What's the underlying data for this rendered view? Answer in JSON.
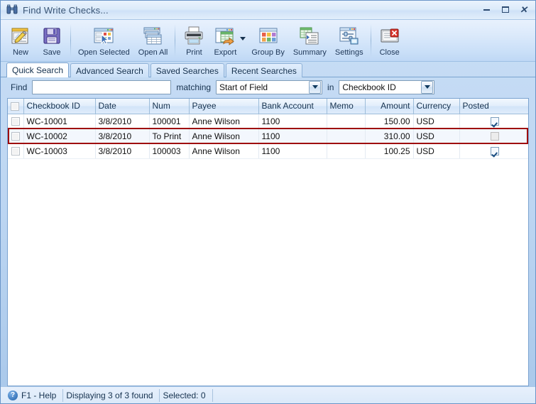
{
  "window": {
    "title": "Find Write Checks...",
    "icon": "binoculars-icon",
    "controls": {
      "minimize": "Minimize",
      "maximize": "Maximize",
      "close": "Close"
    }
  },
  "toolbar": {
    "items": [
      {
        "label": "New",
        "icon": "new-document-icon"
      },
      {
        "label": "Save",
        "icon": "floppy-disk-icon"
      },
      {
        "label": "Open Selected",
        "icon": "open-selected-icon"
      },
      {
        "label": "Open All",
        "icon": "open-all-icon"
      },
      {
        "label": "Print",
        "icon": "printer-icon"
      },
      {
        "label": "Export",
        "icon": "export-icon",
        "has_dropdown": true
      },
      {
        "label": "Group By",
        "icon": "group-by-icon"
      },
      {
        "label": "Summary",
        "icon": "summary-icon"
      },
      {
        "label": "Settings",
        "icon": "settings-icon"
      },
      {
        "label": "Close",
        "icon": "close-window-icon"
      }
    ]
  },
  "tabs": [
    {
      "label": "Quick Search",
      "active": true
    },
    {
      "label": "Advanced Search",
      "active": false
    },
    {
      "label": "Saved Searches",
      "active": false
    },
    {
      "label": "Recent Searches",
      "active": false
    }
  ],
  "search": {
    "find_label": "Find",
    "find_value": "",
    "find_placeholder": "",
    "matching_label": "matching",
    "matching_value": "Start of Field",
    "in_label": "in",
    "in_value": "Checkbook ID"
  },
  "grid": {
    "columns": [
      {
        "key": "select",
        "label": "",
        "align": "center"
      },
      {
        "key": "checkbook_id",
        "label": "Checkbook ID",
        "align": "left"
      },
      {
        "key": "date",
        "label": "Date",
        "align": "left"
      },
      {
        "key": "num",
        "label": "Num",
        "align": "left"
      },
      {
        "key": "payee",
        "label": "Payee",
        "align": "left"
      },
      {
        "key": "bank_account",
        "label": "Bank Account",
        "align": "left"
      },
      {
        "key": "memo",
        "label": "Memo",
        "align": "left"
      },
      {
        "key": "amount",
        "label": "Amount",
        "align": "right"
      },
      {
        "key": "currency",
        "label": "Currency",
        "align": "left"
      },
      {
        "key": "posted",
        "label": "Posted",
        "align": "center"
      }
    ],
    "rows": [
      {
        "selected": false,
        "highlighted": false,
        "checkbook_id": "WC-10001",
        "date": "3/8/2010",
        "num": "100001",
        "payee": "Anne Wilson",
        "bank_account": "1100",
        "memo": "",
        "amount": "150.00",
        "currency": "USD",
        "posted": true
      },
      {
        "selected": false,
        "highlighted": true,
        "checkbook_id": "WC-10002",
        "date": "3/8/2010",
        "num": "To Print",
        "payee": "Anne Wilson",
        "bank_account": "1100",
        "memo": "",
        "amount": "310.00",
        "currency": "USD",
        "posted": false
      },
      {
        "selected": false,
        "highlighted": false,
        "checkbook_id": "WC-10003",
        "date": "3/8/2010",
        "num": "100003",
        "payee": "Anne Wilson",
        "bank_account": "1100",
        "memo": "",
        "amount": "100.25",
        "currency": "USD",
        "posted": true
      }
    ]
  },
  "statusbar": {
    "help": "F1 - Help",
    "displaying": "Displaying 3 of 3 found",
    "selected": "Selected: 0"
  },
  "colors": {
    "highlight_border": "#9e0a0a",
    "frame": "#6a95c8",
    "accent": "#1f5fa8"
  }
}
